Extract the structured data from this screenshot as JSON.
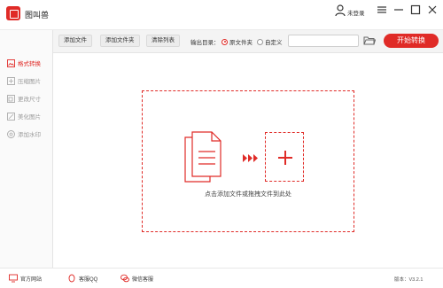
{
  "app": {
    "name": "图叫兽"
  },
  "header": {
    "login_label": "未登录"
  },
  "toolbar": {
    "add_file": "添加文件",
    "add_folder": "添加文件夹",
    "clear_list": "清除列表",
    "output_label": "输出目录：",
    "radio_source": "原文件夹",
    "radio_custom": "自定义",
    "path_value": "",
    "start": "开始转换"
  },
  "sidebar": {
    "items": [
      {
        "label": "格式转换",
        "icon": "image-convert-icon"
      },
      {
        "label": "压缩图片",
        "icon": "compress-icon"
      },
      {
        "label": "更改尺寸",
        "icon": "resize-icon"
      },
      {
        "label": "美化图片",
        "icon": "beautify-icon"
      },
      {
        "label": "添加水印",
        "icon": "watermark-icon"
      }
    ]
  },
  "main": {
    "hint": "点击添加文件或拖拽文件到此处"
  },
  "footer": {
    "website": "官方网站",
    "qq": "客服QQ",
    "wechat": "微信客服",
    "version": "版本：V3.2.1"
  },
  "colors": {
    "accent": "#e02b27"
  }
}
